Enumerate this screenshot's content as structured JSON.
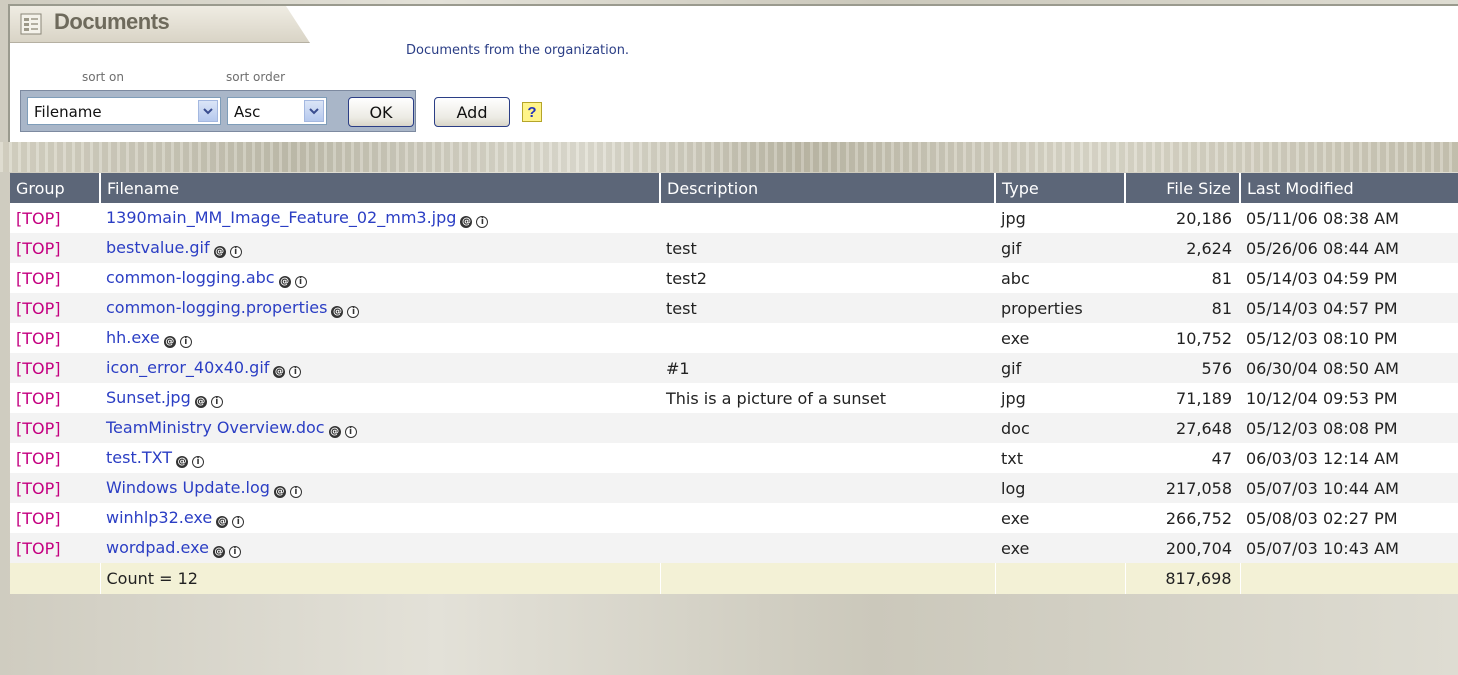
{
  "header": {
    "title": "Documents",
    "description": "Documents from the organization."
  },
  "sort": {
    "sort_on_label": "sort on",
    "sort_order_label": "sort order",
    "sort_field_value": "Filename",
    "sort_order_value": "Asc",
    "ok_label": "OK"
  },
  "actions": {
    "add_label": "Add",
    "help_label": "?"
  },
  "table": {
    "columns": [
      "Group",
      "Filename",
      "Description",
      "Type",
      "File Size",
      "Last Modified"
    ],
    "rows": [
      {
        "group": "[TOP]",
        "filename": "1390main_MM_Image_Feature_02_mm3.jpg",
        "description": "",
        "type": "jpg",
        "size": "20,186",
        "modified": "05/11/06 08:38 AM"
      },
      {
        "group": "[TOP]",
        "filename": "bestvalue.gif",
        "description": "test",
        "type": "gif",
        "size": "2,624",
        "modified": "05/26/06 08:44 AM"
      },
      {
        "group": "[TOP]",
        "filename": "common-logging.abc",
        "description": "test2",
        "type": "abc",
        "size": "81",
        "modified": "05/14/03 04:59 PM"
      },
      {
        "group": "[TOP]",
        "filename": "common-logging.properties",
        "description": "test",
        "type": "properties",
        "size": "81",
        "modified": "05/14/03 04:57 PM"
      },
      {
        "group": "[TOP]",
        "filename": "hh.exe",
        "description": "",
        "type": "exe",
        "size": "10,752",
        "modified": "05/12/03 08:10 PM"
      },
      {
        "group": "[TOP]",
        "filename": "icon_error_40x40.gif",
        "description": "#1",
        "type": "gif",
        "size": "576",
        "modified": "06/30/04 08:50 AM"
      },
      {
        "group": "[TOP]",
        "filename": "Sunset.jpg",
        "description": "This is a picture of a sunset",
        "type": "jpg",
        "size": "71,189",
        "modified": "10/12/04 09:53 PM"
      },
      {
        "group": "[TOP]",
        "filename": "TeamMinistry Overview.doc",
        "description": "",
        "type": "doc",
        "size": "27,648",
        "modified": "05/12/03 08:08 PM"
      },
      {
        "group": "[TOP]",
        "filename": "test.TXT",
        "description": "",
        "type": "txt",
        "size": "47",
        "modified": "06/03/03 12:14 AM"
      },
      {
        "group": "[TOP]",
        "filename": "Windows Update.log",
        "description": "",
        "type": "log",
        "size": "217,058",
        "modified": "05/07/03 10:44 AM"
      },
      {
        "group": "[TOP]",
        "filename": "winhlp32.exe",
        "description": "",
        "type": "exe",
        "size": "266,752",
        "modified": "05/08/03 02:27 PM"
      },
      {
        "group": "[TOP]",
        "filename": "wordpad.exe",
        "description": "",
        "type": "exe",
        "size": "200,704",
        "modified": "05/07/03 10:43 AM"
      }
    ],
    "footer": {
      "count_label": "Count = 12",
      "total_size": "817,698"
    }
  },
  "icons": {
    "title": "document-list-icon",
    "row_email": "email-icon",
    "row_info": "info-icon",
    "select_arrow": "chevron-down-icon",
    "help": "help-icon"
  },
  "colors": {
    "header_bg": "#5c6678",
    "group_link": "#c40080",
    "filename_link": "#2b3ec4",
    "footer_bg": "#f3f1d6",
    "button_border": "#2b3e86"
  }
}
